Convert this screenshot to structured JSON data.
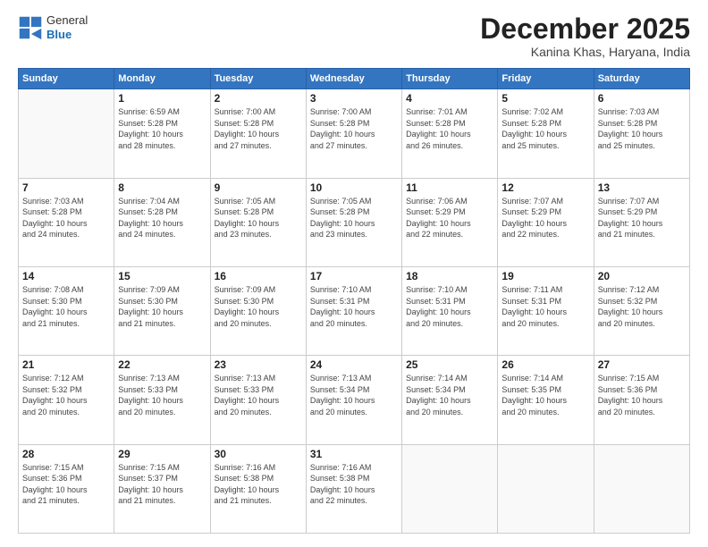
{
  "header": {
    "logo": {
      "general": "General",
      "blue": "Blue"
    },
    "title": "December 2025",
    "location": "Kanina Khas, Haryana, India"
  },
  "days_of_week": [
    "Sunday",
    "Monday",
    "Tuesday",
    "Wednesday",
    "Thursday",
    "Friday",
    "Saturday"
  ],
  "weeks": [
    [
      {
        "day": "",
        "info": ""
      },
      {
        "day": "1",
        "info": "Sunrise: 6:59 AM\nSunset: 5:28 PM\nDaylight: 10 hours\nand 28 minutes."
      },
      {
        "day": "2",
        "info": "Sunrise: 7:00 AM\nSunset: 5:28 PM\nDaylight: 10 hours\nand 27 minutes."
      },
      {
        "day": "3",
        "info": "Sunrise: 7:00 AM\nSunset: 5:28 PM\nDaylight: 10 hours\nand 27 minutes."
      },
      {
        "day": "4",
        "info": "Sunrise: 7:01 AM\nSunset: 5:28 PM\nDaylight: 10 hours\nand 26 minutes."
      },
      {
        "day": "5",
        "info": "Sunrise: 7:02 AM\nSunset: 5:28 PM\nDaylight: 10 hours\nand 25 minutes."
      },
      {
        "day": "6",
        "info": "Sunrise: 7:03 AM\nSunset: 5:28 PM\nDaylight: 10 hours\nand 25 minutes."
      }
    ],
    [
      {
        "day": "7",
        "info": "Sunrise: 7:03 AM\nSunset: 5:28 PM\nDaylight: 10 hours\nand 24 minutes."
      },
      {
        "day": "8",
        "info": "Sunrise: 7:04 AM\nSunset: 5:28 PM\nDaylight: 10 hours\nand 24 minutes."
      },
      {
        "day": "9",
        "info": "Sunrise: 7:05 AM\nSunset: 5:28 PM\nDaylight: 10 hours\nand 23 minutes."
      },
      {
        "day": "10",
        "info": "Sunrise: 7:05 AM\nSunset: 5:28 PM\nDaylight: 10 hours\nand 23 minutes."
      },
      {
        "day": "11",
        "info": "Sunrise: 7:06 AM\nSunset: 5:29 PM\nDaylight: 10 hours\nand 22 minutes."
      },
      {
        "day": "12",
        "info": "Sunrise: 7:07 AM\nSunset: 5:29 PM\nDaylight: 10 hours\nand 22 minutes."
      },
      {
        "day": "13",
        "info": "Sunrise: 7:07 AM\nSunset: 5:29 PM\nDaylight: 10 hours\nand 21 minutes."
      }
    ],
    [
      {
        "day": "14",
        "info": "Sunrise: 7:08 AM\nSunset: 5:30 PM\nDaylight: 10 hours\nand 21 minutes."
      },
      {
        "day": "15",
        "info": "Sunrise: 7:09 AM\nSunset: 5:30 PM\nDaylight: 10 hours\nand 21 minutes."
      },
      {
        "day": "16",
        "info": "Sunrise: 7:09 AM\nSunset: 5:30 PM\nDaylight: 10 hours\nand 20 minutes."
      },
      {
        "day": "17",
        "info": "Sunrise: 7:10 AM\nSunset: 5:31 PM\nDaylight: 10 hours\nand 20 minutes."
      },
      {
        "day": "18",
        "info": "Sunrise: 7:10 AM\nSunset: 5:31 PM\nDaylight: 10 hours\nand 20 minutes."
      },
      {
        "day": "19",
        "info": "Sunrise: 7:11 AM\nSunset: 5:31 PM\nDaylight: 10 hours\nand 20 minutes."
      },
      {
        "day": "20",
        "info": "Sunrise: 7:12 AM\nSunset: 5:32 PM\nDaylight: 10 hours\nand 20 minutes."
      }
    ],
    [
      {
        "day": "21",
        "info": "Sunrise: 7:12 AM\nSunset: 5:32 PM\nDaylight: 10 hours\nand 20 minutes."
      },
      {
        "day": "22",
        "info": "Sunrise: 7:13 AM\nSunset: 5:33 PM\nDaylight: 10 hours\nand 20 minutes."
      },
      {
        "day": "23",
        "info": "Sunrise: 7:13 AM\nSunset: 5:33 PM\nDaylight: 10 hours\nand 20 minutes."
      },
      {
        "day": "24",
        "info": "Sunrise: 7:13 AM\nSunset: 5:34 PM\nDaylight: 10 hours\nand 20 minutes."
      },
      {
        "day": "25",
        "info": "Sunrise: 7:14 AM\nSunset: 5:34 PM\nDaylight: 10 hours\nand 20 minutes."
      },
      {
        "day": "26",
        "info": "Sunrise: 7:14 AM\nSunset: 5:35 PM\nDaylight: 10 hours\nand 20 minutes."
      },
      {
        "day": "27",
        "info": "Sunrise: 7:15 AM\nSunset: 5:36 PM\nDaylight: 10 hours\nand 20 minutes."
      }
    ],
    [
      {
        "day": "28",
        "info": "Sunrise: 7:15 AM\nSunset: 5:36 PM\nDaylight: 10 hours\nand 21 minutes."
      },
      {
        "day": "29",
        "info": "Sunrise: 7:15 AM\nSunset: 5:37 PM\nDaylight: 10 hours\nand 21 minutes."
      },
      {
        "day": "30",
        "info": "Sunrise: 7:16 AM\nSunset: 5:38 PM\nDaylight: 10 hours\nand 21 minutes."
      },
      {
        "day": "31",
        "info": "Sunrise: 7:16 AM\nSunset: 5:38 PM\nDaylight: 10 hours\nand 22 minutes."
      },
      {
        "day": "",
        "info": ""
      },
      {
        "day": "",
        "info": ""
      },
      {
        "day": "",
        "info": ""
      }
    ]
  ]
}
